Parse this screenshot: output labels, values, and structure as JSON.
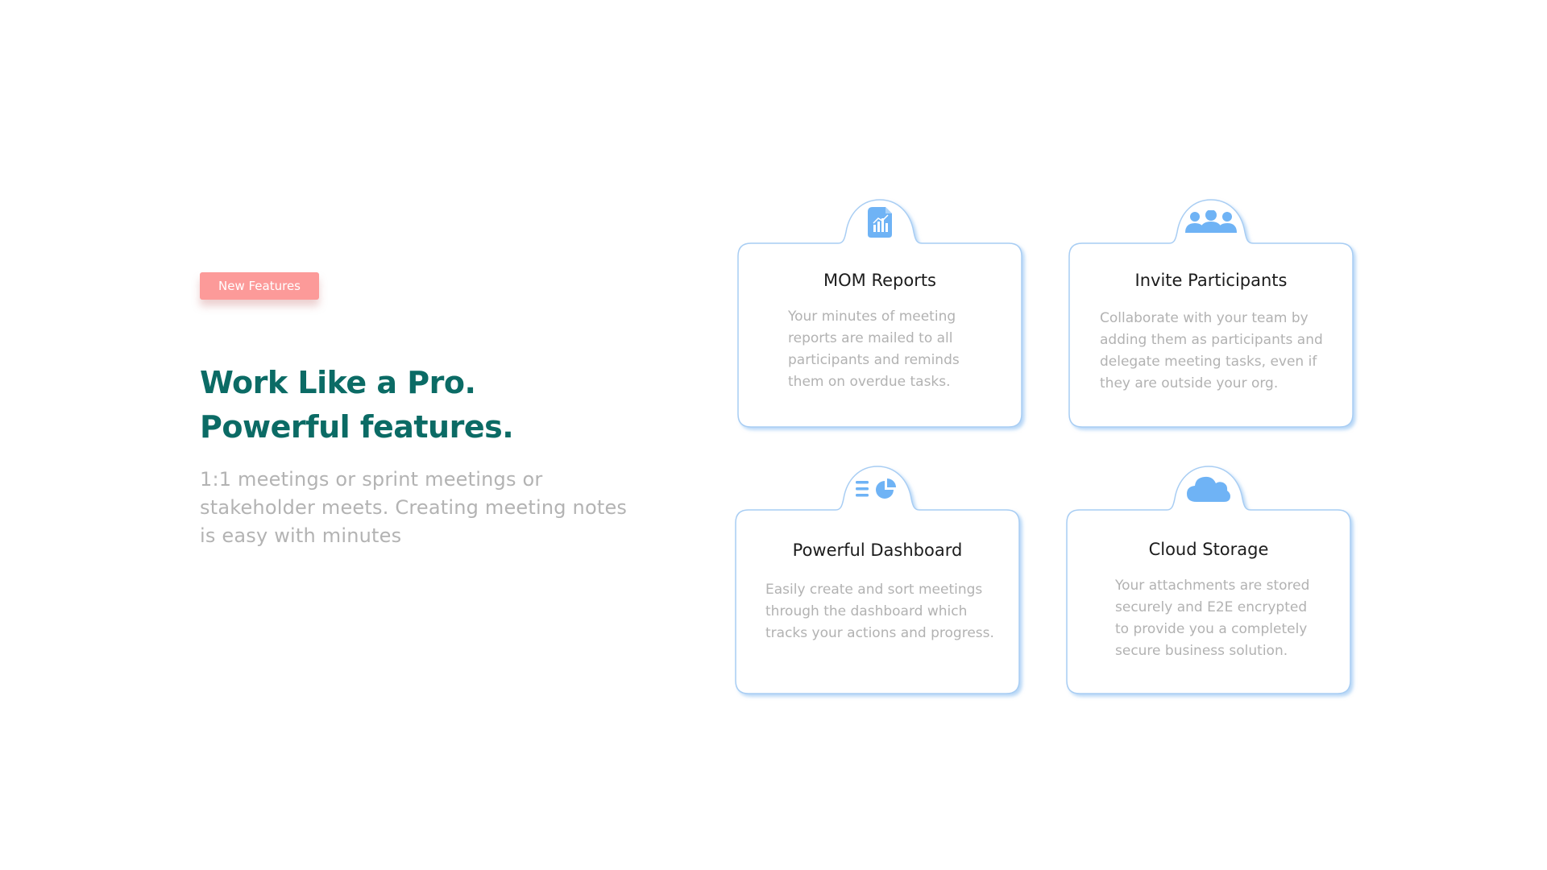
{
  "hero": {
    "badge_label": "New Features",
    "title_line1": "Work Like a Pro.",
    "title_line2": "Powerful features.",
    "description": "1:1 meetings or sprint meetings or stakeholder meets. Creating meeting notes is easy with minutes"
  },
  "features": [
    {
      "icon": "report-document-icon",
      "title": "MOM Reports",
      "description": "Your minutes of meeting reports are mailed to all participants and reminds them on overdue tasks."
    },
    {
      "icon": "users-group-icon",
      "title": "Invite Participants",
      "description": "Collaborate with your team by adding them as participants and delegate meeting tasks, even if they are outside your org."
    },
    {
      "icon": "dashboard-pie-icon",
      "title": "Powerful Dashboard",
      "description": "Easily create and sort meetings through the dashboard which tracks your actions and progress."
    },
    {
      "icon": "cloud-icon",
      "title": "Cloud Storage",
      "description": "Your attachments are stored securely and E2E encrypted to provide you a completely secure business solution."
    }
  ],
  "colors": {
    "accent_teal": "#0b6b65",
    "badge_pink": "#fc9a99",
    "icon_blue": "#6fb3f5",
    "card_border": "#a8cdf3"
  }
}
